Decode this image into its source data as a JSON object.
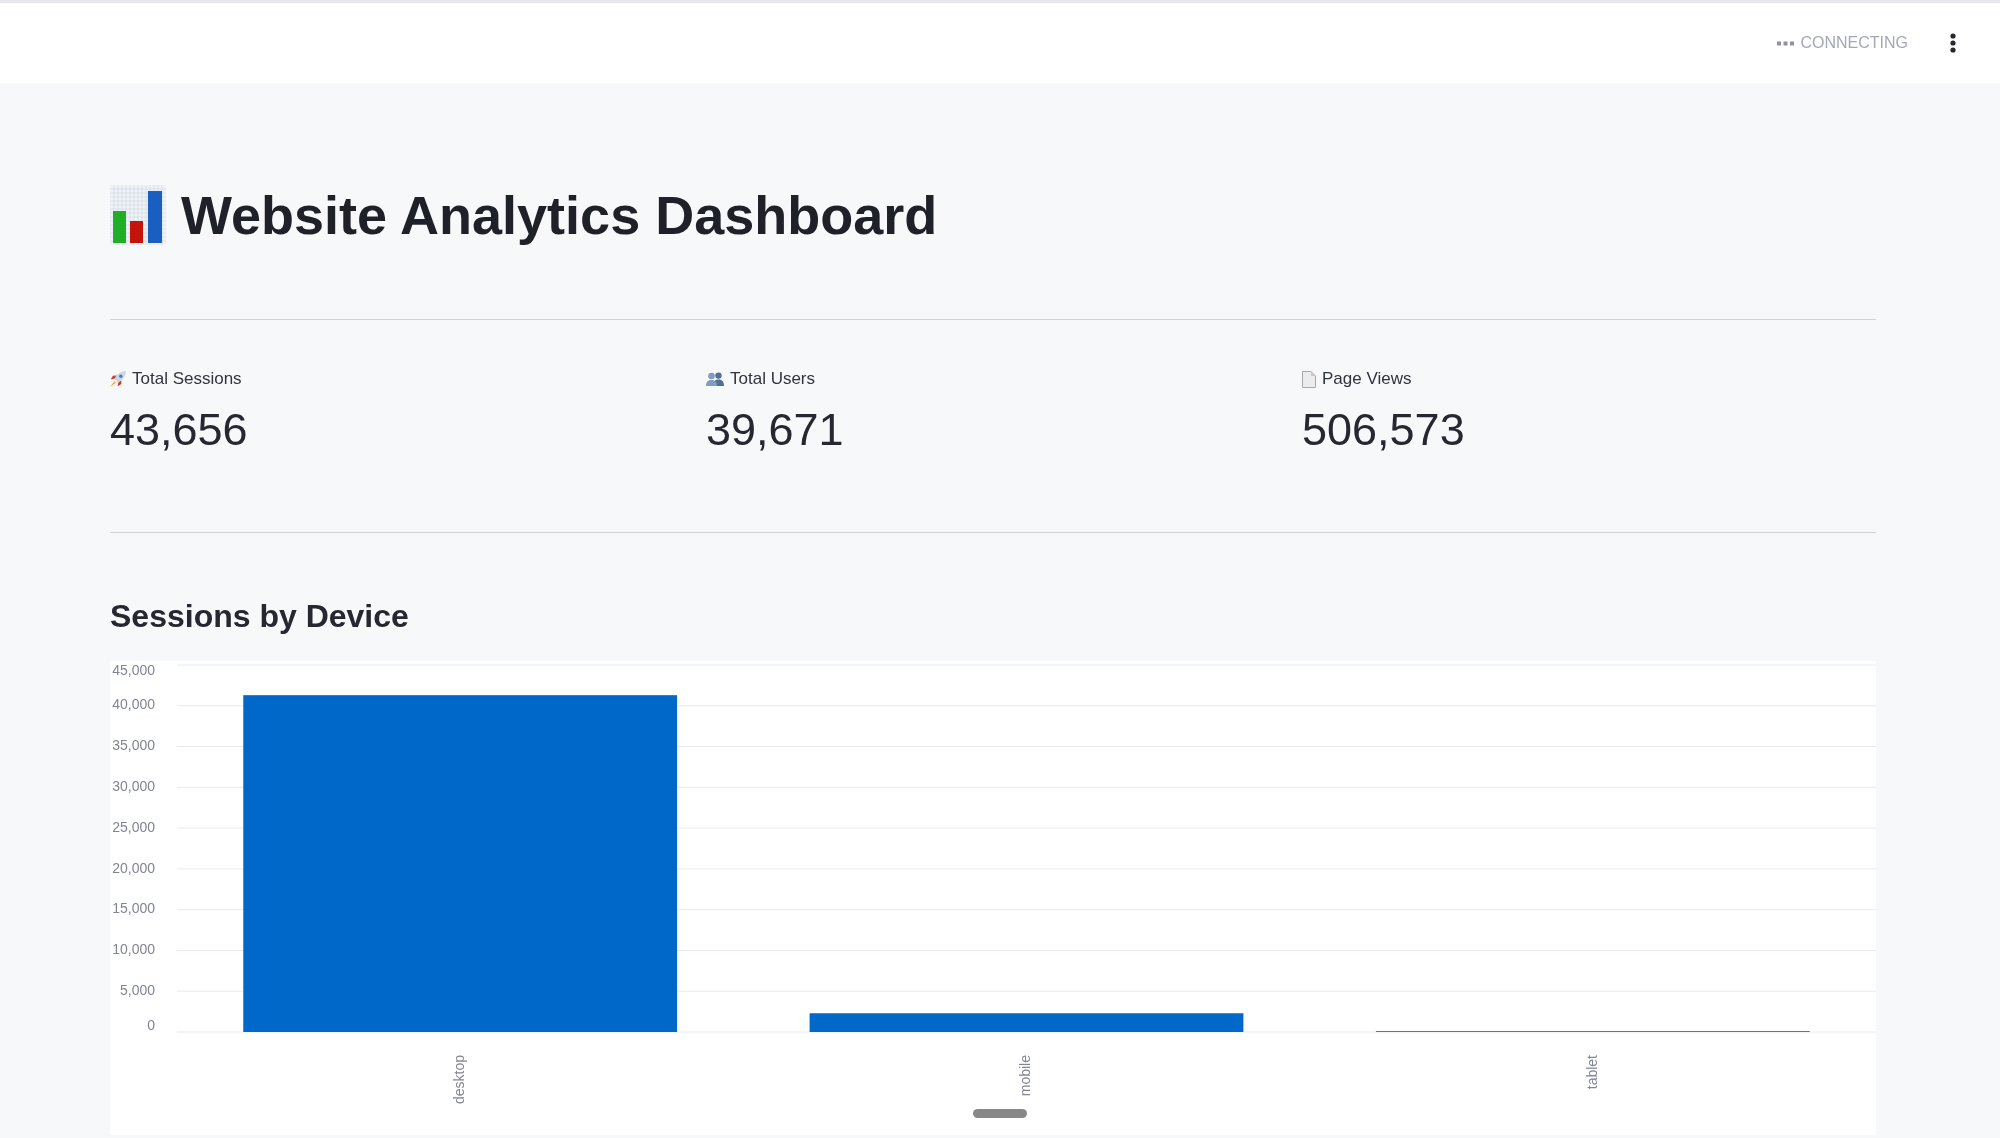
{
  "header": {
    "status": "CONNECTING"
  },
  "title": "Website Analytics Dashboard",
  "metrics": [
    {
      "label": "Total Sessions",
      "value": "43,656"
    },
    {
      "label": "Total Users",
      "value": "39,671"
    },
    {
      "label": "Page Views",
      "value": "506,573"
    }
  ],
  "chart_section": {
    "title": "Sessions by Device",
    "chart_data": {
      "type": "bar",
      "categories": [
        "desktop",
        "mobile",
        "tablet"
      ],
      "values": [
        41300,
        2300,
        100
      ],
      "ylim": [
        0,
        45000
      ],
      "grid": true,
      "yticks": [
        {
          "value": 0,
          "label": "0"
        },
        {
          "value": 5000,
          "label": "5,000"
        },
        {
          "value": 10000,
          "label": "10,000"
        },
        {
          "value": 15000,
          "label": "15,000"
        },
        {
          "value": 20000,
          "label": "20,000"
        },
        {
          "value": 25000,
          "label": "25,000"
        },
        {
          "value": 30000,
          "label": "30,000"
        },
        {
          "value": 35000,
          "label": "35,000"
        },
        {
          "value": 40000,
          "label": "40,000"
        },
        {
          "value": 45000,
          "label": "45,000"
        }
      ]
    }
  }
}
